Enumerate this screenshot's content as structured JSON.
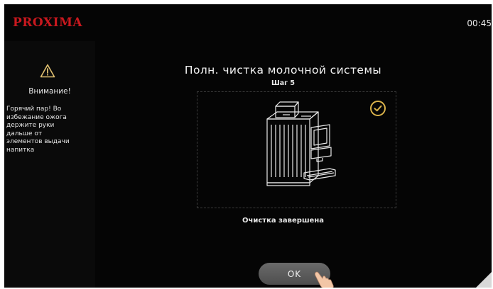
{
  "header": {
    "brand": "PROXIMA",
    "clock": "00:45"
  },
  "sidebar": {
    "warning_icon": "warning-triangle-icon",
    "warning_title": "Внимание!",
    "warning_text": "Горячий пар! Во\nизбежание ожога\nдержите руки\nдальше от\nэлементов выдачи\nнапитка"
  },
  "main": {
    "title": "Полн. чистка молочной системы",
    "step": "Шаг 5",
    "illustration_icon": "coffee-machine-icon",
    "check_icon": "checkmark-circle-icon",
    "status": "Очистка завершена",
    "ok_label": "OK"
  },
  "colors": {
    "brand": "#c8181e",
    "background": "#050505",
    "accent_check": "#d9b24a",
    "button": "#5c5c5c"
  }
}
